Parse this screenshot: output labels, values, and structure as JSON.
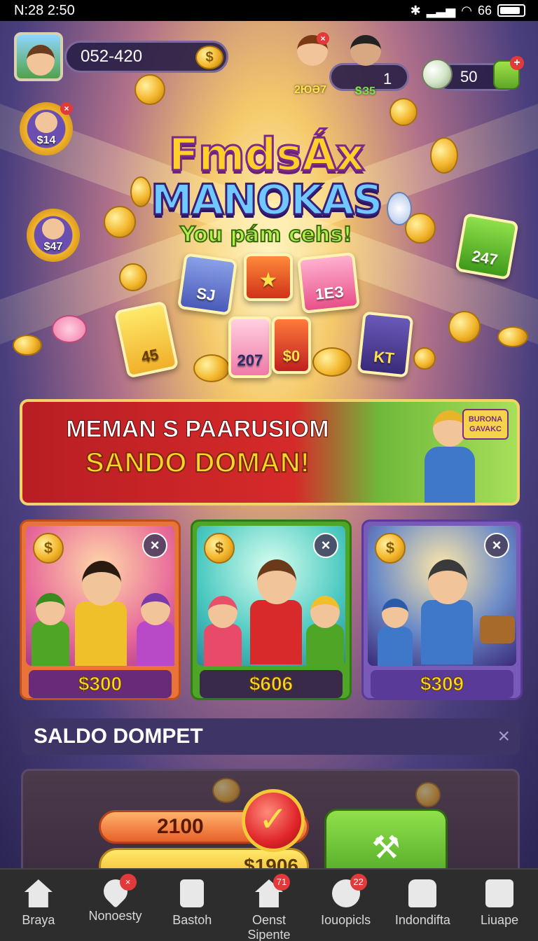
{
  "status_bar": {
    "time": "N:28 2:50",
    "battery": "66"
  },
  "header": {
    "player_id": "052-420",
    "friends": [
      {
        "label": "2ЮӘ7"
      },
      {
        "label": "ՏЗ5"
      }
    ],
    "friends_count": "1",
    "gems": "50",
    "plus": "+"
  },
  "side_tokens": [
    "$14",
    "$47"
  ],
  "logo": {
    "line1": "FmdsÁx",
    "line2": "MANOKAS",
    "line3": "You pám cehs!"
  },
  "tiles": [
    "SJ",
    "1ЕЗ",
    "45",
    "207",
    "$0",
    "KT",
    "247"
  ],
  "banner": {
    "line1": "MEMAN S PAARUSIOM",
    "line2": "SANDO DOMAN!",
    "tag": "BURONA GAVAKC"
  },
  "offers": [
    {
      "price": "$300",
      "close": "×"
    },
    {
      "price": "$606",
      "close": "×"
    },
    {
      "price": "$309",
      "close": "×"
    }
  ],
  "wallet": {
    "title": "SALDO DOMPET",
    "close": "×",
    "top_value": "2100",
    "bottom_value": "$1906"
  },
  "nav": [
    {
      "label": "Braya",
      "icon": "home-icon",
      "badge": ""
    },
    {
      "label": "Nonoesty",
      "icon": "heart-icon",
      "badge": "×"
    },
    {
      "label": "Bastoh",
      "icon": "document-icon",
      "badge": ""
    },
    {
      "label": "Oenst Sipente",
      "icon": "house-icon",
      "badge": "71"
    },
    {
      "label": "Iouopicls",
      "icon": "chat-icon",
      "badge": "22"
    },
    {
      "label": "Indondifta",
      "icon": "grid-icon",
      "badge": ""
    },
    {
      "label": "Liuape",
      "icon": "bag-icon",
      "badge": ""
    }
  ],
  "colors": {
    "accent_gold": "#ffd42a",
    "banner_red": "#d62a2a",
    "go_green": "#5fa626",
    "badge_red": "#e23a3a"
  }
}
